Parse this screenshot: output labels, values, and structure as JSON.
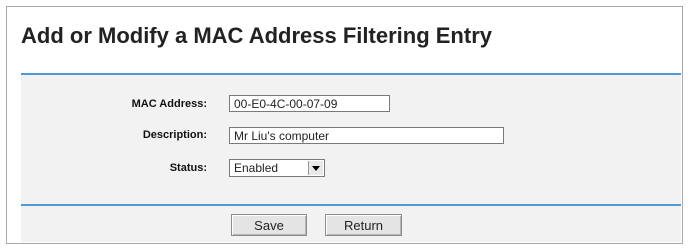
{
  "page": {
    "title": "Add or Modify a MAC Address Filtering Entry"
  },
  "form": {
    "mac_label": "MAC Address:",
    "mac_value": "00-E0-4C-00-07-09",
    "description_label": "Description:",
    "description_value": "Mr Liu's computer",
    "status_label": "Status:",
    "status_selected": "Enabled",
    "status_icon": "chevron-down-icon"
  },
  "buttons": {
    "save_label": "Save",
    "return_label": "Return"
  },
  "colors": {
    "divider": "#4f9ad3",
    "form_background": "#f2f2f2"
  }
}
